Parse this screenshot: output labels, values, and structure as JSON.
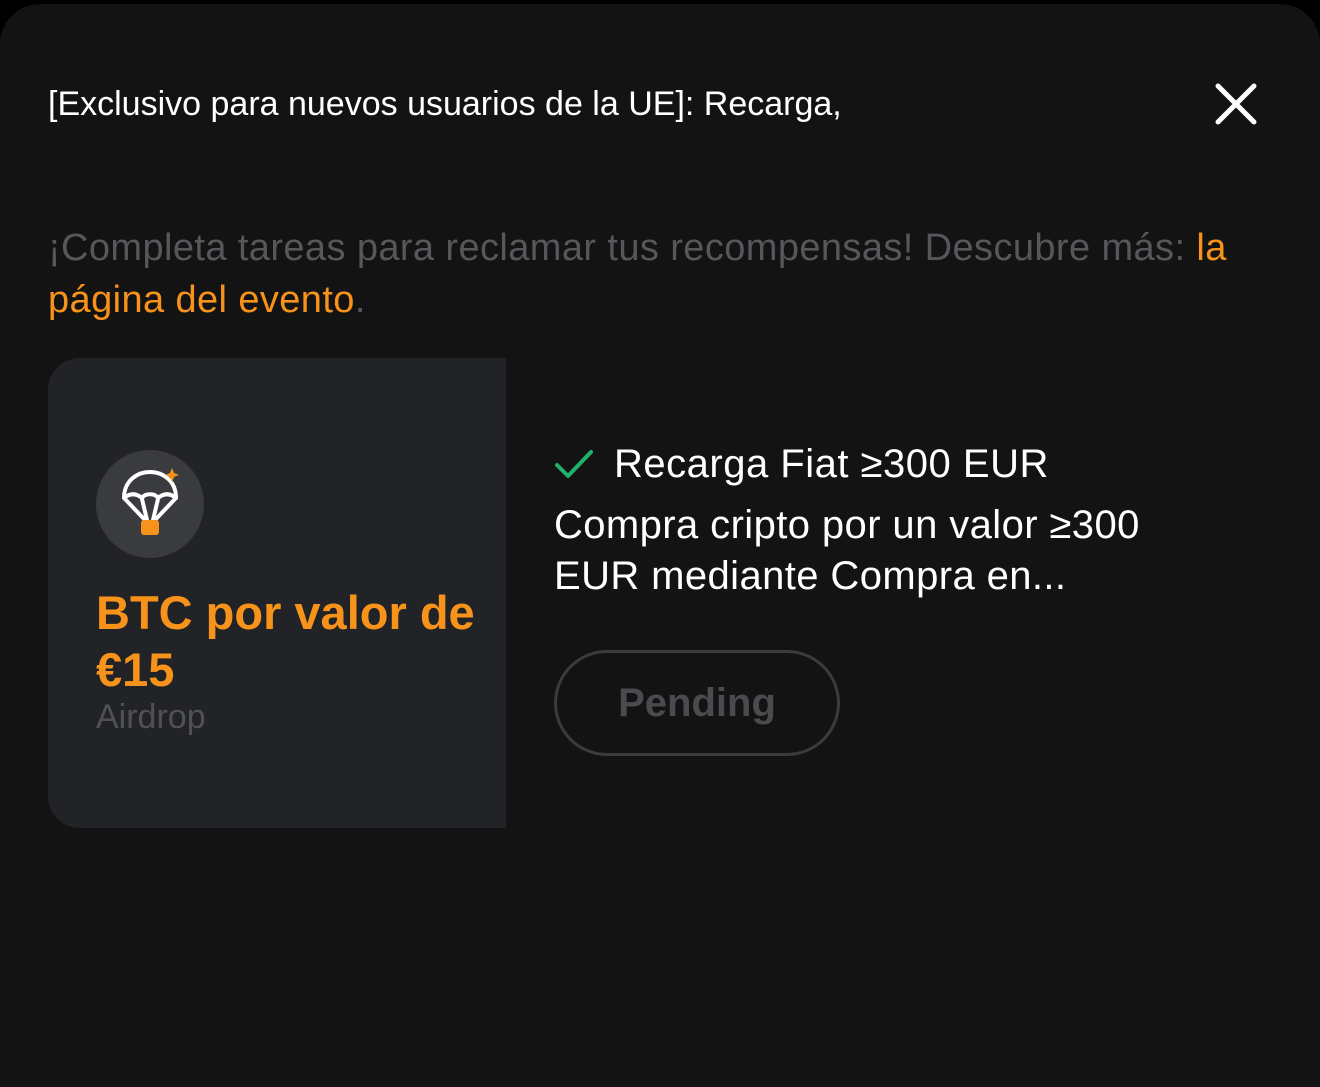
{
  "modal": {
    "title": "[Exclusivo para nuevos usuarios de la UE]: Recarga,",
    "close_icon": "close-icon"
  },
  "description": {
    "text_before": "¡Completa tareas para reclamar tus recompensas! Descubre más: ",
    "link_text": "la página del evento",
    "text_after": "."
  },
  "reward": {
    "icon": "parachute-icon",
    "title": "BTC por valor de €15",
    "subtitle": "Airdrop"
  },
  "task": {
    "status_icon": "check-icon",
    "title": "Recarga Fiat ≥300 EUR",
    "description": "Compra cripto por un valor ≥300 EUR mediante Compra en...",
    "button_label": "Pending"
  },
  "colors": {
    "accent": "#f7931a",
    "success": "#20b26c",
    "background": "#131314",
    "card": "#222326"
  }
}
